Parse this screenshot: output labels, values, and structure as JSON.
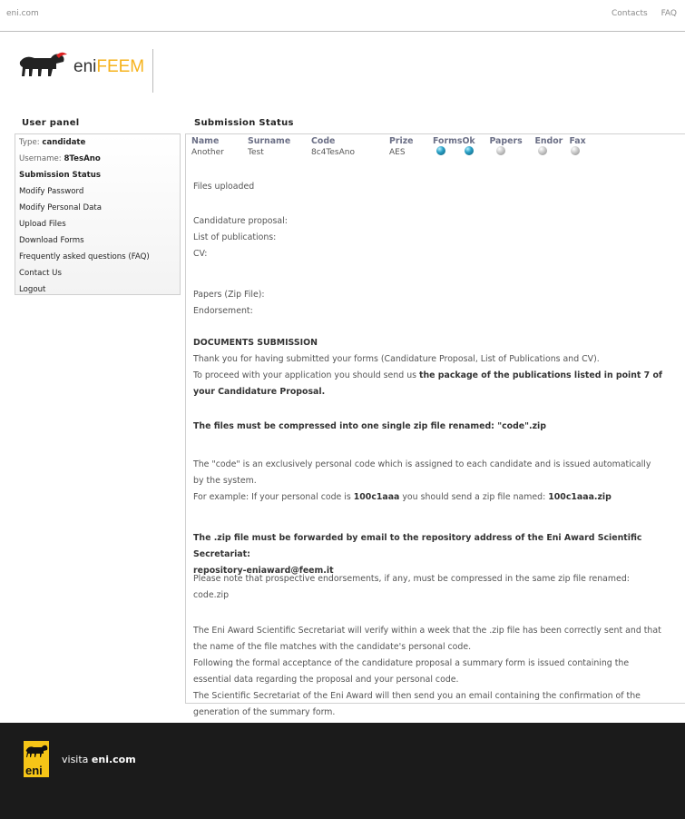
{
  "topbar": {
    "site": "eni.com",
    "links": [
      "Contacts",
      "FAQ"
    ]
  },
  "logo": {
    "brand_prefix": "eni",
    "brand_suffix": "FEEM"
  },
  "sidebar": {
    "title": "User panel",
    "type_label": "Type:",
    "type_value": "candidate",
    "username_label": "Username:",
    "username_value": "8TesAno",
    "items": [
      "Submission Status",
      "Modify Password",
      "Modify Personal Data",
      "Upload Files",
      "Download Forms",
      "Frequently asked questions (FAQ)",
      "Contact Us",
      "Logout"
    ]
  },
  "main": {
    "title": "Submission Status",
    "table": {
      "headers": [
        "Name",
        "Surname",
        "Code",
        "Prize",
        "Forms",
        "Ok",
        "Papers",
        "Endor",
        "Fax"
      ],
      "row": [
        "Another",
        "Test",
        "8c4TesAno",
        "AES"
      ],
      "status_icons": [
        "on",
        "on",
        "off",
        "off",
        "off"
      ]
    },
    "files_uploaded": "Files uploaded",
    "files": [
      "Candidature proposal:",
      "List of publications:",
      "CV:",
      "Papers (Zip File):",
      "Endorsement:"
    ],
    "doc_heading": "DOCUMENTS SUBMISSION",
    "p1": "Thank you for having submitted your forms (Candidature Proposal, List of Publications and CV).",
    "p2a": "To proceed with your application you should send us ",
    "p2b": "the package of the publications listed in point 7 of",
    "p2c": "your Candidature Proposal.",
    "p3": "The files must be compressed into one single zip file renamed: \"code\".zip",
    "p4a": "The \"code\" is an exclusively personal code which is assigned to each candidate and is issued automatically",
    "p4b": "by the system.",
    "p5a": "For example: If your personal code is ",
    "p5b": "100c1aaa",
    "p5c": " you should send a zip file named: ",
    "p5d": "100c1aaa.zip",
    "p6a": "The .zip file must be forwarded by email to the repository address of the Eni Award Scientific Secretariat:",
    "p6b": "repository-eniaward@feem.it",
    "p7a": "Please note that prospective endorsements, if any, must be compressed in the same zip file renamed:",
    "p7b": "code.zip",
    "p8a": "The Eni Award Scientific Secretariat will verify within a week that the .zip file has been correctly sent and that",
    "p8b": "the name of the file matches with the candidate's personal code.",
    "p8c": "Following the formal acceptance of the candidature proposal a summary form is issued containing the",
    "p8d": "essential data regarding the proposal and your personal code.",
    "p8e": "The Scientific Secretariat of the Eni Award will then send you an email containing the confirmation of the",
    "p8f": "generation of the summary form."
  },
  "footer": {
    "visit_prefix": "visita ",
    "visit_link": "eni.com",
    "logo_text": "eni"
  },
  "colors": {
    "brand_yellow": "#f6b21b",
    "footer_bg": "#1b1b1b",
    "header_blue": "#6b6f86"
  }
}
